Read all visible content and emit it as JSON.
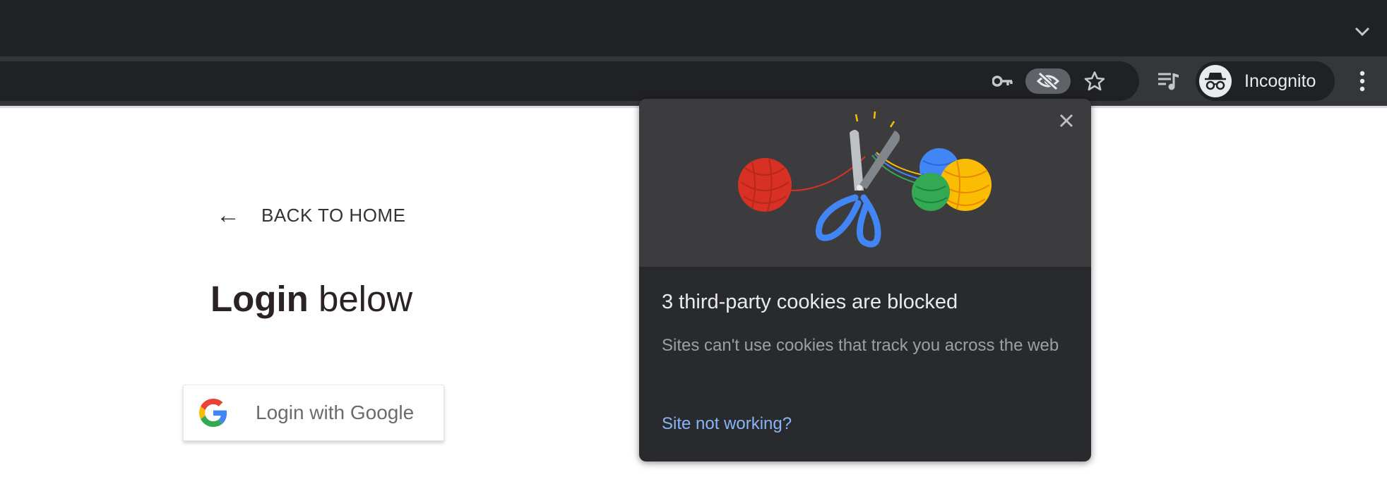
{
  "browser": {
    "incognito_label": "Incognito",
    "icons": {
      "password_key": "key-icon",
      "third_party_cookies": "eye-off-icon",
      "bookmark": "star-icon",
      "media_controls": "media-queue-icon",
      "menu": "more-vert-icon",
      "tab_dropdown": "chevron-down-icon",
      "incognito_avatar": "incognito-icon"
    }
  },
  "page": {
    "back_link_text": "BACK TO HOME",
    "title_bold": "Login",
    "title_rest": " below",
    "google_button_label": "Login with Google"
  },
  "cookie_popup": {
    "title": "3 third-party cookies are blocked",
    "description": "Sites can't use cookies that track you across the web",
    "link": "Site not working?",
    "illustration": "scissors-cutting-yarn-illustration"
  },
  "colors": {
    "chrome_dark": "#202124",
    "toolbar": "#35363a",
    "popup_bg": "#292a2d",
    "link_blue": "#8ab4f8",
    "yarn_red": "#d93025",
    "yarn_blue": "#4285f4",
    "yarn_yellow": "#fbbc04",
    "yarn_green": "#34a853"
  }
}
